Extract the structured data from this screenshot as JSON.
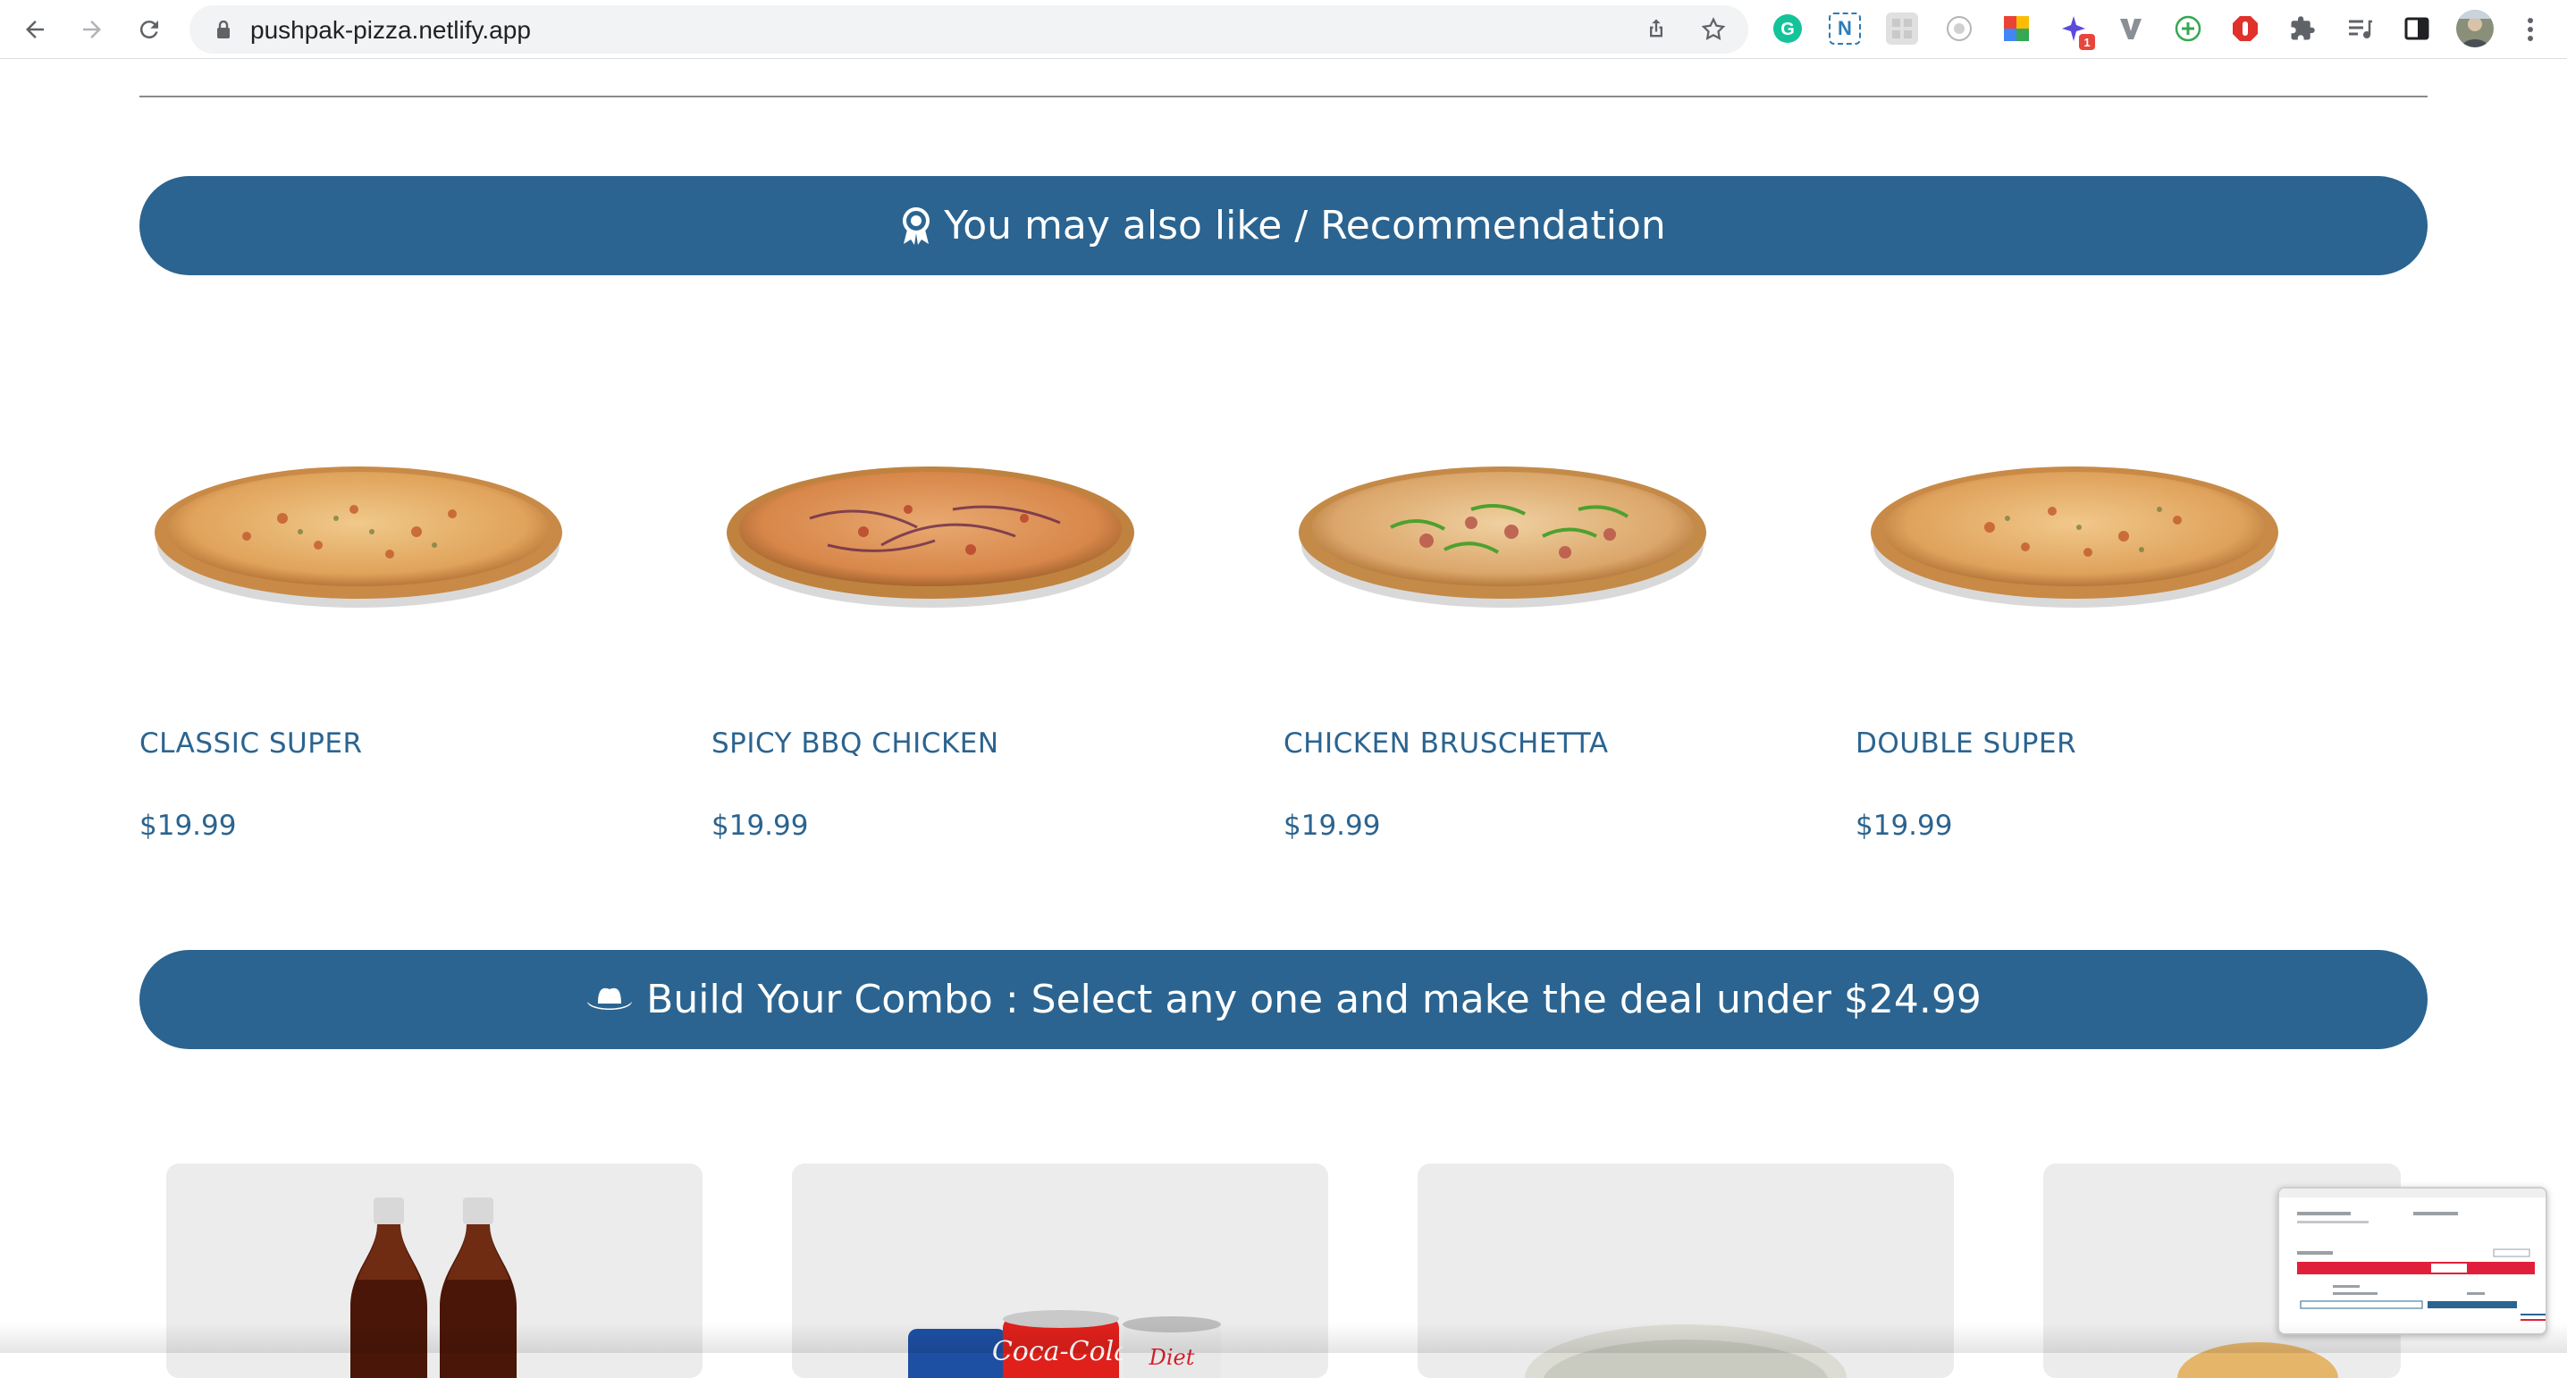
{
  "browser": {
    "url": "pushpak-pizza.netlify.app",
    "extension_badge": "1"
  },
  "recommendation_banner": {
    "icon": "award-icon",
    "text": "You may also like / Recommendation"
  },
  "pizzas": [
    {
      "name": "CLASSIC SUPER",
      "price": "$19.99"
    },
    {
      "name": "SPICY BBQ CHICKEN",
      "price": "$19.99"
    },
    {
      "name": "CHICKEN BRUSCHETTA",
      "price": "$19.99"
    },
    {
      "name": "DOUBLE SUPER",
      "price": "$19.99"
    }
  ],
  "combo_banner": {
    "icon": "hat-icon",
    "text": "Build Your Combo : Select any one and make the deal under $24.99"
  },
  "combo_items": [
    {
      "image": "cola-bottles"
    },
    {
      "image": "soda-cans"
    },
    {
      "image": "side-dish-bowl"
    },
    {
      "image": "side-dish"
    }
  ],
  "mini_preview": {
    "checkout_label": "Checkout",
    "continue_label": "Continue Ordering"
  },
  "colors": {
    "brand": "#2b6490",
    "text": "#2b6490",
    "banner_text": "#ffffff"
  }
}
